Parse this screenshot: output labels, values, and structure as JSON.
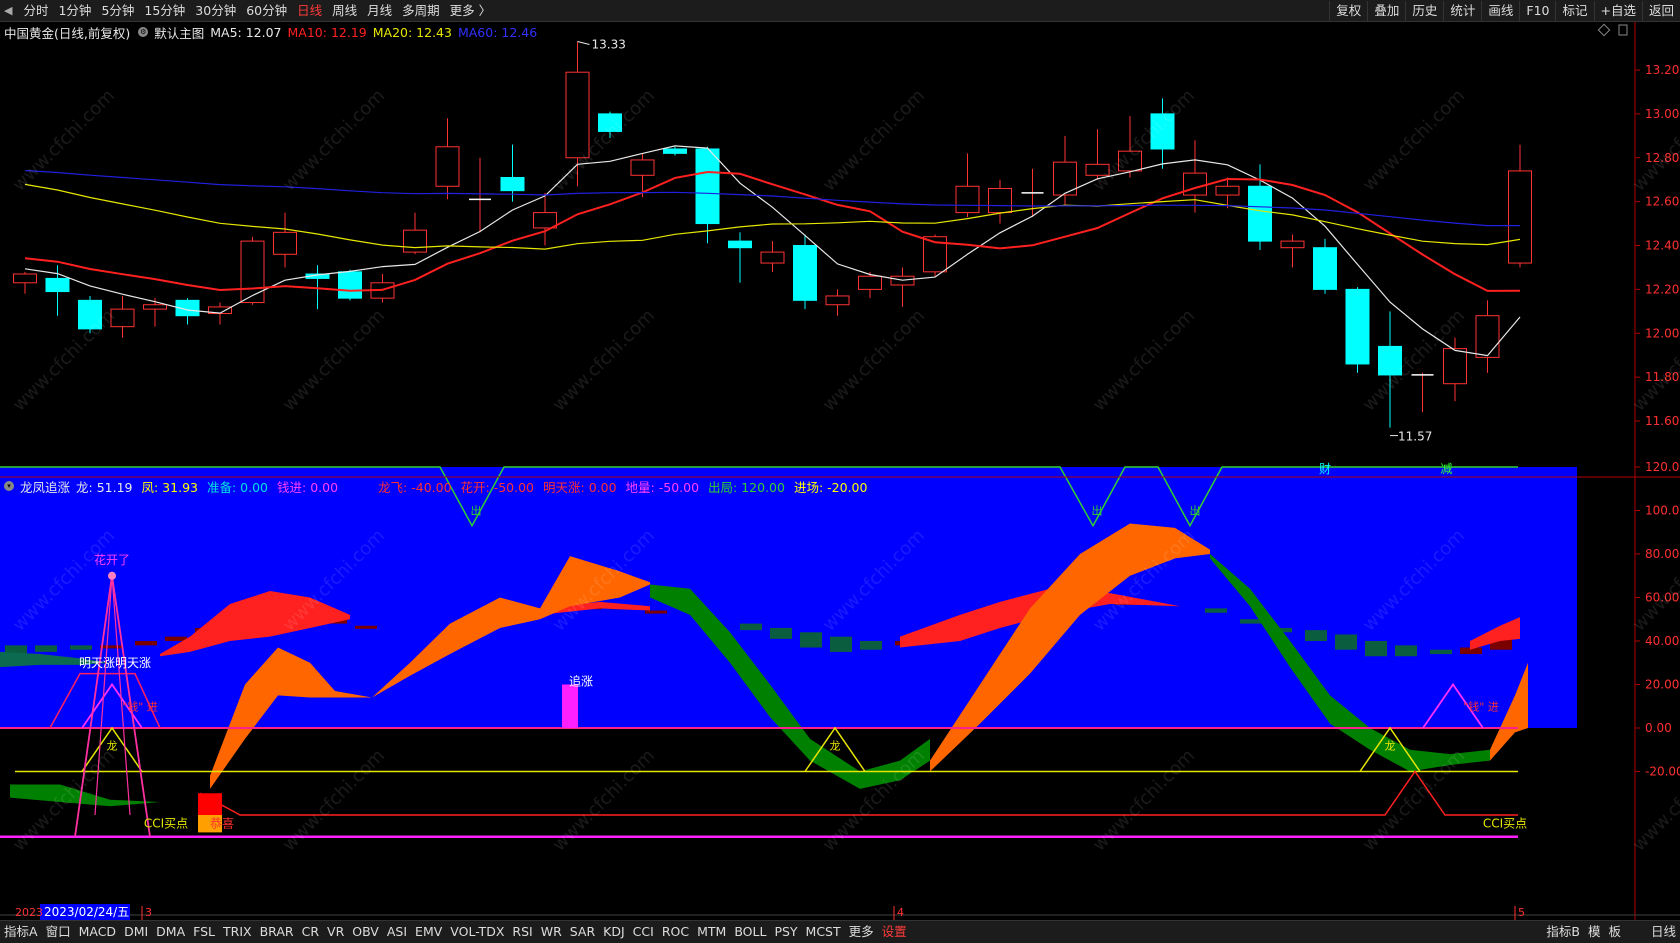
{
  "toolbar": {
    "periods": [
      "分时",
      "1分钟",
      "5分钟",
      "15分钟",
      "30分钟",
      "60分钟",
      "日线",
      "周线",
      "月线",
      "多周期",
      "更多 〉"
    ],
    "active_period_index": 6,
    "right": [
      "复权",
      "叠加",
      "历史",
      "统计",
      "画线",
      "F10",
      "标记",
      "+自选",
      "返回"
    ]
  },
  "main_info": {
    "title": "中国黄金(日线,前复权)",
    "template": "默认主图",
    "ma5": "MA5: 12.07",
    "ma10": "MA10: 12.19",
    "ma20": "MA20: 12.43",
    "ma60": "MA60: 12.46"
  },
  "indicator_info": {
    "name": "龙凤追涨",
    "values": [
      {
        "label": "龙: 51.19",
        "color": "#e8e8e8"
      },
      {
        "label": "凤: 31.93",
        "color": "#ffff00"
      },
      {
        "label": "准备: 0.00",
        "color": "#00e0e0"
      },
      {
        "label": "钱进: 0.00",
        "color": "#ff40ff"
      },
      {
        "label": "龙飞: -40.00",
        "color": "#ff3030"
      },
      {
        "label": "花开: -50.00",
        "color": "#ff3030"
      },
      {
        "label": "明天涨: 0.00",
        "color": "#ff3030"
      },
      {
        "label": "地量: -50.00",
        "color": "#ff40ff"
      },
      {
        "label": "出局: 120.00",
        "color": "#30d030"
      },
      {
        "label": "进场: -20.00",
        "color": "#ffff00"
      }
    ]
  },
  "price_axis": [
    "13.20",
    "13.00",
    "12.80",
    "12.60",
    "12.40",
    "12.20",
    "12.00",
    "11.80",
    "11.60"
  ],
  "indicator_axis": [
    "120.00",
    "100.00",
    "80.00",
    "60.00",
    "40.00",
    "20.00",
    "0.00",
    "-20.00"
  ],
  "annotations": {
    "high": "13.33",
    "low": "11.57",
    "cai": "财",
    "jian": "减",
    "huakaile": "花开了",
    "mingtianzhang": "明天涨明天涨",
    "jin1": "\"钱\" 进",
    "jin2": "\"钱\" 进",
    "long1": "龙",
    "long2": "龙",
    "long3": "龙",
    "zhuizhang": "追涨",
    "cci1": "CCI买点",
    "cci2": "CCI买点",
    "gongxi": "恭喜",
    "chu1": "出",
    "chu2": "出",
    "chu3": "出"
  },
  "date_axis": {
    "year": "2023",
    "cursor": "2023/02/24/五",
    "m3": "3",
    "m4": "4",
    "m5": "5"
  },
  "bottom": {
    "items": [
      "指标A",
      "窗口",
      "MACD",
      "DMI",
      "DMA",
      "FSL",
      "TRIX",
      "BRAR",
      "CR",
      "VR",
      "OBV",
      "ASI",
      "EMV",
      "VOL-TDX",
      "RSI",
      "WR",
      "SAR",
      "KDJ",
      "CCI",
      "ROC",
      "MTM",
      "BOLL",
      "PSY",
      "MCST",
      "更多",
      "设置"
    ],
    "right": [
      "指标B",
      "模",
      "板",
      "日线"
    ]
  },
  "colors": {
    "up": "#ff3232",
    "down": "#00ffff",
    "ma5": "#e8e8e8",
    "ma10": "#ff2020",
    "ma20": "#e6e600",
    "ma60": "#2020e0",
    "panel_bg": "#0000ff",
    "axis": "#b00000"
  },
  "chart_data": {
    "type": "candlestick",
    "ylim": [
      11.5,
      13.3
    ],
    "candles": [
      {
        "o": 12.23,
        "h": 12.28,
        "l": 12.18,
        "c": 12.27
      },
      {
        "o": 12.25,
        "h": 12.31,
        "l": 12.08,
        "c": 12.19
      },
      {
        "o": 12.15,
        "h": 12.17,
        "l": 12.0,
        "c": 12.02
      },
      {
        "o": 12.03,
        "h": 12.17,
        "l": 11.98,
        "c": 12.11
      },
      {
        "o": 12.11,
        "h": 12.16,
        "l": 12.03,
        "c": 12.13
      },
      {
        "o": 12.15,
        "h": 12.16,
        "l": 12.04,
        "c": 12.08
      },
      {
        "o": 12.09,
        "h": 12.14,
        "l": 12.04,
        "c": 12.12
      },
      {
        "o": 12.14,
        "h": 12.44,
        "l": 12.13,
        "c": 12.42
      },
      {
        "o": 12.36,
        "h": 12.55,
        "l": 12.3,
        "c": 12.46
      },
      {
        "o": 12.27,
        "h": 12.31,
        "l": 12.11,
        "c": 12.25
      },
      {
        "o": 12.28,
        "h": 12.29,
        "l": 12.15,
        "c": 12.16
      },
      {
        "o": 12.16,
        "h": 12.27,
        "l": 12.14,
        "c": 12.23
      },
      {
        "o": 12.37,
        "h": 12.55,
        "l": 12.36,
        "c": 12.47
      },
      {
        "o": 12.67,
        "h": 12.98,
        "l": 12.61,
        "c": 12.85
      },
      {
        "o": 12.6,
        "h": 12.8,
        "l": 12.46,
        "c": 12.61
      },
      {
        "o": 12.71,
        "h": 12.86,
        "l": 12.6,
        "c": 12.65
      },
      {
        "o": 12.48,
        "h": 12.64,
        "l": 12.4,
        "c": 12.55
      },
      {
        "o": 12.8,
        "h": 13.33,
        "l": 12.67,
        "c": 13.19
      },
      {
        "o": 13.0,
        "h": 13.01,
        "l": 12.89,
        "c": 12.92
      },
      {
        "o": 12.72,
        "h": 12.82,
        "l": 12.62,
        "c": 12.79
      },
      {
        "o": 12.84,
        "h": 12.85,
        "l": 12.81,
        "c": 12.82
      },
      {
        "o": 12.84,
        "h": 12.85,
        "l": 12.41,
        "c": 12.5
      },
      {
        "o": 12.42,
        "h": 12.46,
        "l": 12.23,
        "c": 12.39
      },
      {
        "o": 12.32,
        "h": 12.42,
        "l": 12.28,
        "c": 12.37
      },
      {
        "o": 12.4,
        "h": 12.45,
        "l": 12.11,
        "c": 12.15
      },
      {
        "o": 12.13,
        "h": 12.2,
        "l": 12.08,
        "c": 12.17
      },
      {
        "o": 12.2,
        "h": 12.28,
        "l": 12.16,
        "c": 12.26
      },
      {
        "o": 12.22,
        "h": 12.3,
        "l": 12.12,
        "c": 12.26
      },
      {
        "o": 12.28,
        "h": 12.45,
        "l": 12.26,
        "c": 12.44
      },
      {
        "o": 12.55,
        "h": 12.82,
        "l": 12.53,
        "c": 12.67
      },
      {
        "o": 12.55,
        "h": 12.7,
        "l": 12.5,
        "c": 12.66
      },
      {
        "o": 12.64,
        "h": 12.75,
        "l": 12.53,
        "c": 12.64
      },
      {
        "o": 12.63,
        "h": 12.9,
        "l": 12.58,
        "c": 12.78
      },
      {
        "o": 12.72,
        "h": 12.93,
        "l": 12.7,
        "c": 12.77
      },
      {
        "o": 12.74,
        "h": 12.99,
        "l": 12.71,
        "c": 12.83
      },
      {
        "o": 13.0,
        "h": 13.07,
        "l": 12.75,
        "c": 12.84
      },
      {
        "o": 12.63,
        "h": 12.88,
        "l": 12.55,
        "c": 12.73
      },
      {
        "o": 12.63,
        "h": 12.71,
        "l": 12.57,
        "c": 12.67
      },
      {
        "o": 12.67,
        "h": 12.77,
        "l": 12.38,
        "c": 12.42
      },
      {
        "o": 12.39,
        "h": 12.45,
        "l": 12.3,
        "c": 12.42
      },
      {
        "o": 12.39,
        "h": 12.43,
        "l": 12.18,
        "c": 12.2
      },
      {
        "o": 12.2,
        "h": 12.21,
        "l": 11.82,
        "c": 11.86
      },
      {
        "o": 11.94,
        "h": 12.1,
        "l": 11.57,
        "c": 11.81
      },
      {
        "o": 11.8,
        "h": 11.82,
        "l": 11.64,
        "c": 11.81
      },
      {
        "o": 11.77,
        "h": 11.98,
        "l": 11.69,
        "c": 11.93
      },
      {
        "o": 11.89,
        "h": 12.15,
        "l": 11.82,
        "c": 12.08
      },
      {
        "o": 12.32,
        "h": 12.86,
        "l": 12.3,
        "c": 12.74
      }
    ]
  }
}
